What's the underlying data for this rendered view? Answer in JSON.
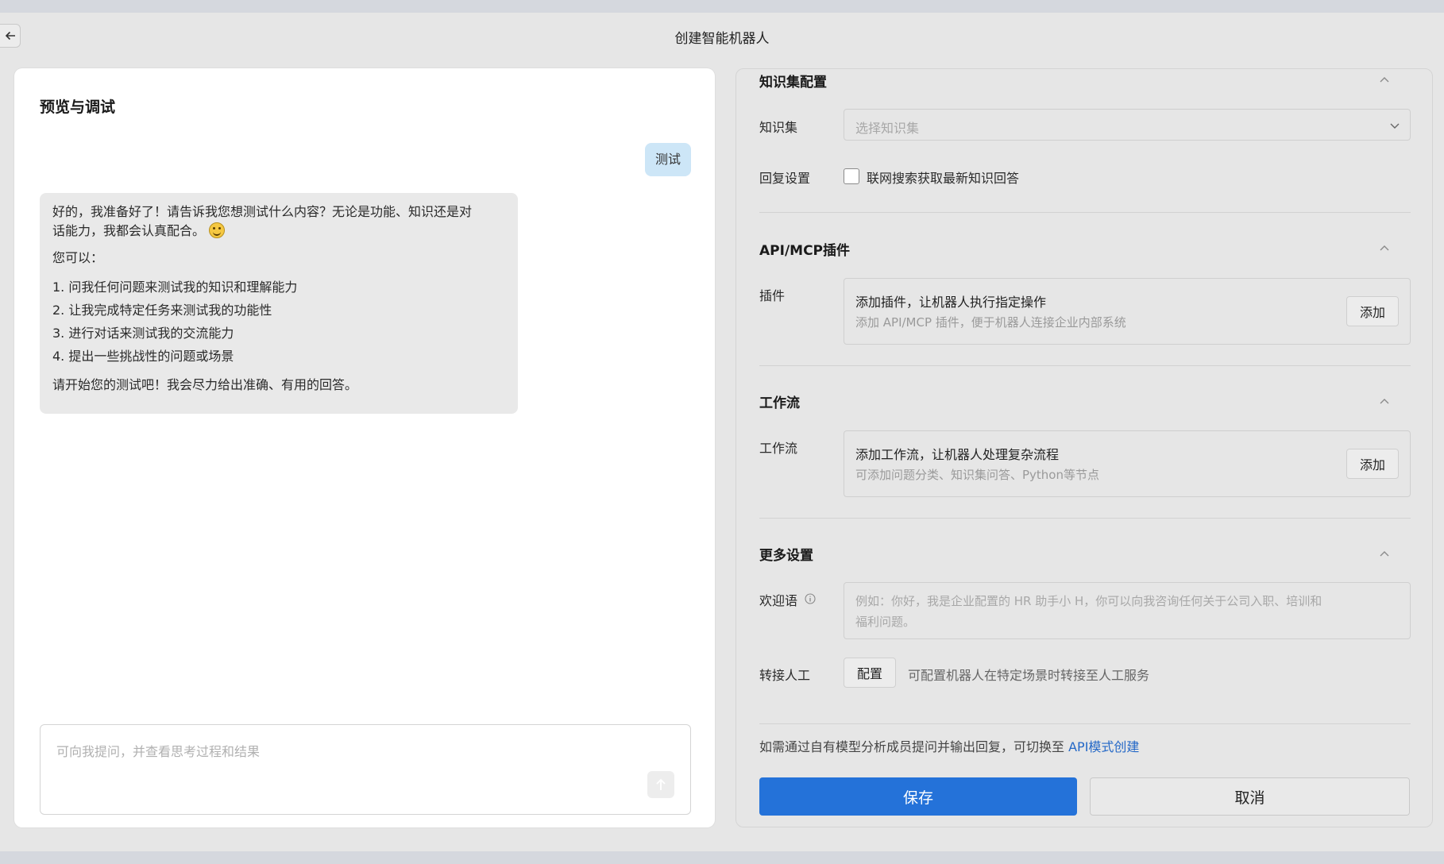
{
  "header": {
    "title": "创建智能机器人"
  },
  "preview": {
    "title": "预览与调试",
    "user_message": "测试",
    "bot_message": {
      "line1": "好的，我准备好了！请告诉我您想测试什么内容？无论是功能、知识还是对",
      "line2": "话能力，我都会认真配合。",
      "intro": "您可以：",
      "items": [
        "1. 问我任何问题来测试我的知识和理解能力",
        "2. 让我完成特定任务来测试我的功能性",
        "3. 进行对话来测试我的交流能力",
        "4. 提出一些挑战性的问题或场景"
      ],
      "outro": "请开始您的测试吧！我会尽力给出准确、有用的回答。"
    },
    "input_placeholder": "可向我提问，并查看思考过程和结果"
  },
  "knowledge": {
    "section_title": "知识集配置",
    "kb_label": "知识集",
    "kb_placeholder": "选择知识集",
    "reply_label": "回复设置",
    "web_search_label": "联网搜索获取最新知识回答",
    "web_search_checked": false
  },
  "plugins": {
    "section_title": "API/MCP插件",
    "label": "插件",
    "card_title": "添加插件，让机器人执行指定操作",
    "card_sub": "添加 API/MCP 插件，便于机器人连接企业内部系统",
    "add_label": "添加"
  },
  "workflow": {
    "section_title": "工作流",
    "label": "工作流",
    "card_title": "添加工作流，让机器人处理复杂流程",
    "card_sub": "可添加问题分类、知识集问答、Python等节点",
    "add_label": "添加"
  },
  "more": {
    "section_title": "更多设置",
    "welcome_label": "欢迎语",
    "welcome_placeholder_line1": "例如：你好，我是企业配置的 HR 助手小 H，你可以向我咨询任何关于公司入职、培训和",
    "welcome_placeholder_line2": "福利问题。",
    "transfer_label": "转接人工",
    "transfer_button": "配置",
    "transfer_desc": "可配置机器人在特定场景时转接至人工服务"
  },
  "footer": {
    "note": "如需通过自有模型分析成员提问并输出回复，可切换至",
    "note_link": "API模式创建",
    "save_label": "保存",
    "cancel_label": "取消"
  },
  "colors": {
    "primary": "#2472d9",
    "user_bubble": "#cde6f7",
    "link": "#2468c7"
  }
}
